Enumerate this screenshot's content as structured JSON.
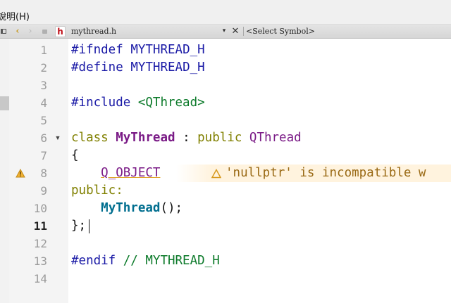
{
  "menubar": {
    "help_label": "說明(H)"
  },
  "toolbar": {
    "back_icon": "chevron-left-icon",
    "forward_icon": "chevron-right-icon",
    "file_type_letter": "h",
    "file_name": "mythread.h",
    "dropdown_glyph": "▾",
    "close_glyph": "✕",
    "symbol_selector": "<Select Symbol>"
  },
  "editor": {
    "current_line": 11,
    "lines": [
      {
        "n": "1"
      },
      {
        "n": "2"
      },
      {
        "n": "3"
      },
      {
        "n": "4"
      },
      {
        "n": "5"
      },
      {
        "n": "6",
        "fold": "▼"
      },
      {
        "n": "7"
      },
      {
        "n": "8"
      },
      {
        "n": "9"
      },
      {
        "n": "10"
      },
      {
        "n": "11"
      },
      {
        "n": "12"
      },
      {
        "n": "13"
      },
      {
        "n": "14"
      }
    ],
    "code": {
      "l1_directive": "#ifndef",
      "l1_macro": "MYTHREAD_H",
      "l2_directive": "#define",
      "l2_macro": "MYTHREAD_H",
      "l4_directive": "#include",
      "l4_header": "<QThread>",
      "l6_kw": "class",
      "l6_name": "MyThread",
      "l6_colon": " : ",
      "l6_access": "public",
      "l6_base": "QThread",
      "l7": "{",
      "l8_macro": "Q_OBJECT",
      "l9": "public:",
      "l10_fn": "MyThread",
      "l10_rest": "();",
      "l11": "};",
      "l13_directive": "#endif",
      "l13_comment": "// MYTHREAD_H"
    },
    "warning": {
      "line": 8,
      "text": "'nullptr' is incompatible w",
      "color": "#e0a52a"
    }
  }
}
